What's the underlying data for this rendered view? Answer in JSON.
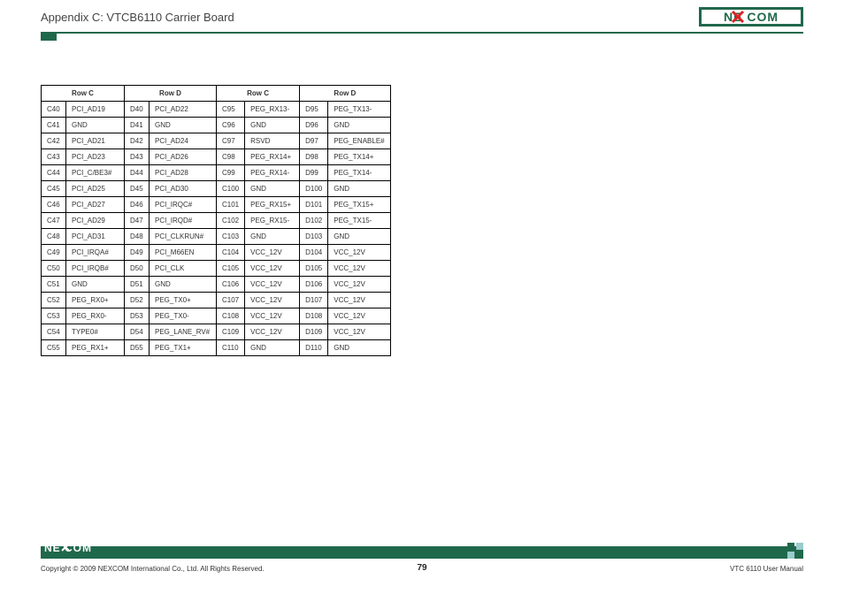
{
  "header": {
    "title": "Appendix C: VTCB6110 Carrier Board",
    "brand": "NEXCOM"
  },
  "table": {
    "headers": [
      "Row C",
      "",
      "Row D",
      "",
      "Row C",
      "",
      "Row D",
      ""
    ],
    "group_headers": [
      "Row C",
      "Row D",
      "Row C",
      "Row D"
    ],
    "rows": [
      [
        "C40",
        "PCI_AD19",
        "D40",
        "PCI_AD22",
        "C95",
        "PEG_RX13-",
        "D95",
        "PEG_TX13-"
      ],
      [
        "C41",
        "GND",
        "D41",
        "GND",
        "C96",
        "GND",
        "D96",
        "GND"
      ],
      [
        "C42",
        "PCI_AD21",
        "D42",
        "PCI_AD24",
        "C97",
        "RSVD",
        "D97",
        "PEG_ENABLE#"
      ],
      [
        "C43",
        "PCI_AD23",
        "D43",
        "PCI_AD26",
        "C98",
        "PEG_RX14+",
        "D98",
        "PEG_TX14+"
      ],
      [
        "C44",
        "PCI_C/BE3#",
        "D44",
        "PCI_AD28",
        "C99",
        "PEG_RX14-",
        "D99",
        "PEG_TX14-"
      ],
      [
        "C45",
        "PCI_AD25",
        "D45",
        "PCI_AD30",
        "C100",
        "GND",
        "D100",
        "GND"
      ],
      [
        "C46",
        "PCI_AD27",
        "D46",
        "PCI_IRQC#",
        "C101",
        "PEG_RX15+",
        "D101",
        "PEG_TX15+"
      ],
      [
        "C47",
        "PCI_AD29",
        "D47",
        "PCI_IRQD#",
        "C102",
        "PEG_RX15-",
        "D102",
        "PEG_TX15-"
      ],
      [
        "C48",
        "PCI_AD31",
        "D48",
        "PCI_CLKRUN#",
        "C103",
        "GND",
        "D103",
        "GND"
      ],
      [
        "C49",
        "PCI_IRQA#",
        "D49",
        "PCI_M66EN",
        "C104",
        "VCC_12V",
        "D104",
        "VCC_12V"
      ],
      [
        "C50",
        "PCI_IRQB#",
        "D50",
        "PCI_CLK",
        "C105",
        "VCC_12V",
        "D105",
        "VCC_12V"
      ],
      [
        "C51",
        "GND",
        "D51",
        "GND",
        "C106",
        "VCC_12V",
        "D106",
        "VCC_12V"
      ],
      [
        "C52",
        "PEG_RX0+",
        "D52",
        "PEG_TX0+",
        "C107",
        "VCC_12V",
        "D107",
        "VCC_12V"
      ],
      [
        "C53",
        "PEG_RX0-",
        "D53",
        "PEG_TX0-",
        "C108",
        "VCC_12V",
        "D108",
        "VCC_12V"
      ],
      [
        "C54",
        "TYPE0#",
        "D54",
        "PEG_LANE_RV#",
        "C109",
        "VCC_12V",
        "D109",
        "VCC_12V"
      ],
      [
        "C55",
        "PEG_RX1+",
        "D55",
        "PEG_TX1+",
        "C110",
        "GND",
        "D110",
        "GND"
      ]
    ]
  },
  "footer": {
    "copyright": "Copyright © 2009 NEXCOM International Co., Ltd. All Rights Reserved.",
    "page": "79",
    "doc": "VTC 6110 User Manual",
    "brand": "NEXCOM"
  }
}
